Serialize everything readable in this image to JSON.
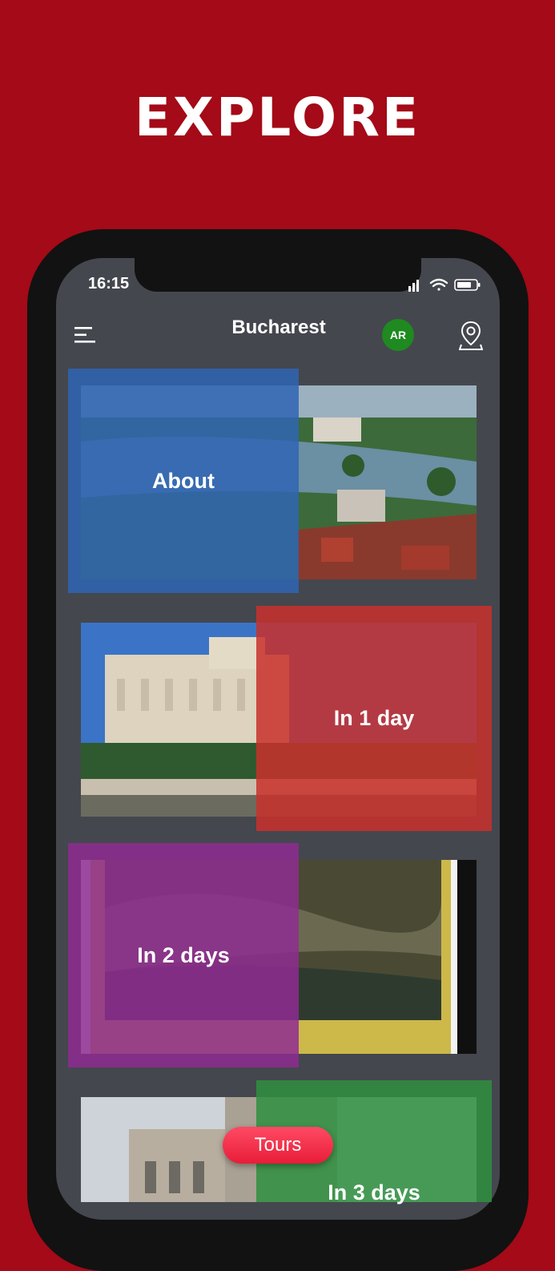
{
  "promo": {
    "headline": "EXPLORE"
  },
  "status_bar": {
    "time": "16:15"
  },
  "nav": {
    "title": "Bucharest",
    "ar_label": "AR"
  },
  "cards": [
    {
      "label": "About",
      "overlay_color": "#2f65b4"
    },
    {
      "label": "In 1 day",
      "overlay_color": "#c9302b"
    },
    {
      "label": "In 2 days",
      "overlay_color": "#8e2b92"
    },
    {
      "label": "In 3 days",
      "overlay_color": "#2f8f3f"
    }
  ],
  "tours_button": {
    "label": "Tours"
  },
  "icons": [
    "menu-icon",
    "map-pin-icon",
    "signal-icon",
    "wifi-icon",
    "battery-icon"
  ]
}
